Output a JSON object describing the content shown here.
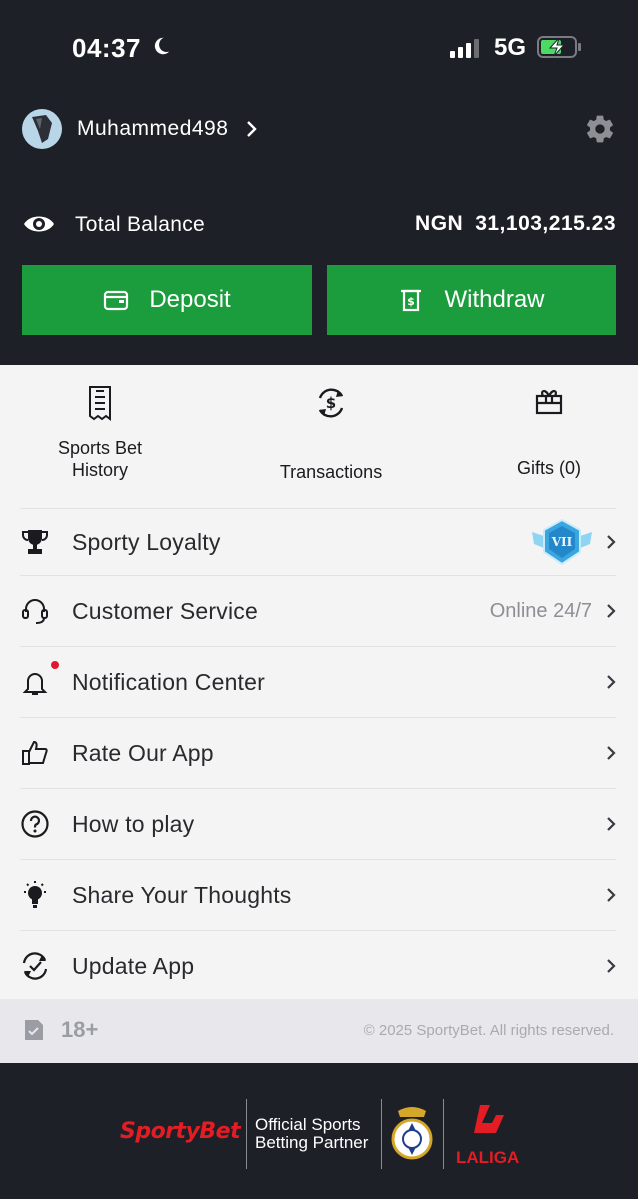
{
  "status_bar": {
    "time": "04:37",
    "network": "5G"
  },
  "profile": {
    "username": "Muhammed498"
  },
  "balance": {
    "label": "Total Balance",
    "currency": "NGN",
    "amount": "31,103,215.23"
  },
  "actions": {
    "deposit_label": "Deposit",
    "withdraw_label": "Withdraw"
  },
  "quick_links": [
    {
      "label": "Sports Bet History",
      "icon": "receipt-icon"
    },
    {
      "label": "Transactions",
      "icon": "transactions-icon"
    },
    {
      "label": "Gifts (0)",
      "icon": "gift-icon"
    }
  ],
  "menu": [
    {
      "label": "Sporty Loyalty",
      "icon": "trophy-icon",
      "badge": "VII"
    },
    {
      "label": "Customer Service",
      "icon": "headset-icon",
      "extra": "Online 24/7"
    },
    {
      "label": "Notification Center",
      "icon": "bell-icon"
    },
    {
      "label": "Rate Our App",
      "icon": "thumbs-up-icon"
    },
    {
      "label": "How to play",
      "icon": "question-icon"
    },
    {
      "label": "Share Your Thoughts",
      "icon": "lightbulb-icon"
    },
    {
      "label": "Update App",
      "icon": "update-icon"
    }
  ],
  "footer": {
    "age_label": "18+",
    "copyright": "© 2025 SportyBet. All rights reserved.",
    "brand": "SportyBet",
    "partner_line1": "Official Sports",
    "partner_line2": "Betting Partner",
    "league": "LALIGA"
  },
  "colors": {
    "dark_bg": "#1e2027",
    "accent_green": "#1b9c3d",
    "brand_red": "#e41c24",
    "panel_bg": "#f4f4f5"
  }
}
